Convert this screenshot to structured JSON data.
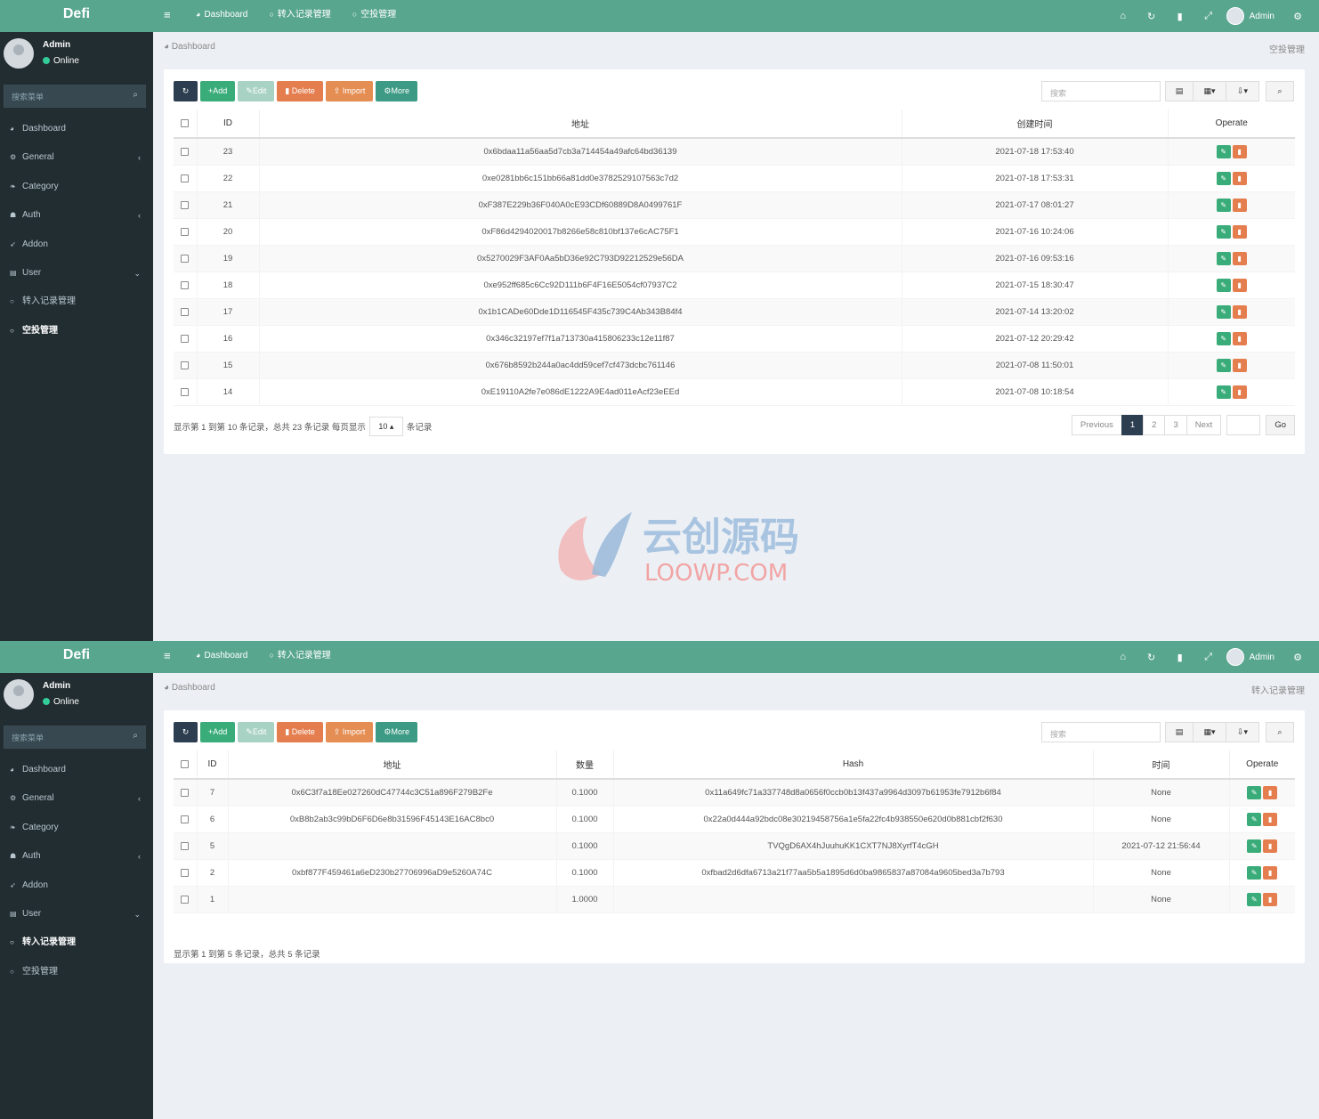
{
  "common": {
    "brand": "Defi",
    "topnav_dashboard": "Dashboard",
    "topnav_transfer": "转入记录管理",
    "topnav_airdrop": "空投管理",
    "admin_name": "Admin",
    "user_name": "Admin",
    "user_status": "Online",
    "sidebar_search": "搜索菜单",
    "breadcrumb": "Dashboard",
    "menu": [
      {
        "label": "Dashboard",
        "icon": "dashboard-icon"
      },
      {
        "label": "General",
        "icon": "cogs-icon",
        "arrow": "‹"
      },
      {
        "label": "Category",
        "icon": "leaf-icon"
      },
      {
        "label": "Auth",
        "icon": "group-icon",
        "arrow": "‹"
      },
      {
        "label": "Addon",
        "icon": "rocket-icon"
      },
      {
        "label": "User",
        "icon": "list-icon",
        "arrow": "⌄"
      },
      {
        "label": "转入记录管理",
        "icon": "circle-icon"
      },
      {
        "label": "空投管理",
        "icon": "circle-icon"
      }
    ],
    "toolbar": {
      "add": "Add",
      "edit": "Edit",
      "delete": "Delete",
      "import": "Import",
      "more": "More"
    },
    "search_placeholder": "搜索"
  },
  "screen1": {
    "breadcrumb_right": "空投管理",
    "columns": {
      "id": "ID",
      "address": "地址",
      "created": "创建时间",
      "operate": "Operate"
    },
    "rows": [
      {
        "id": "23",
        "address": "0x6bdaa11a56aa5d7cb3a714454a49afc64bd36139",
        "created": "2021-07-18 17:53:40"
      },
      {
        "id": "22",
        "address": "0xe0281bb6c151bb66a81dd0e3782529107563c7d2",
        "created": "2021-07-18 17:53:31"
      },
      {
        "id": "21",
        "address": "0xF387E229b36F040A0cE93CDf60889D8A0499761F",
        "created": "2021-07-17 08:01:27"
      },
      {
        "id": "20",
        "address": "0xF86d4294020017b8266e58c810bf137e6cAC75F1",
        "created": "2021-07-16 10:24:06"
      },
      {
        "id": "19",
        "address": "0x5270029F3AF0Aa5bD36e92C793D92212529e56DA",
        "created": "2021-07-16 09:53:16"
      },
      {
        "id": "18",
        "address": "0xe952ff685c6Cc92D111b6F4F16E5054cf07937C2",
        "created": "2021-07-15 18:30:47"
      },
      {
        "id": "17",
        "address": "0x1b1CADe60Dde1D116545F435c739C4Ab343B84f4",
        "created": "2021-07-14 13:20:02"
      },
      {
        "id": "16",
        "address": "0x346c32197ef7f1a713730a415806233c12e11f87",
        "created": "2021-07-12 20:29:42"
      },
      {
        "id": "15",
        "address": "0x676b8592b244a0ac4dd59cef7cf473dcbc761146",
        "created": "2021-07-08 11:50:01"
      },
      {
        "id": "14",
        "address": "0xE19110A2fe7e086dE1222A9E4ad011eAcf23eEEd",
        "created": "2021-07-08 10:18:54"
      }
    ],
    "pagination_info_1": "显示第 1 到第 10 条记录，总共 23 条记录 每页显示",
    "page_size": "10",
    "pagination_info_2": "条记录",
    "pager": {
      "prev": "Previous",
      "p1": "1",
      "p2": "2",
      "p3": "3",
      "next": "Next",
      "go": "Go"
    }
  },
  "screen2": {
    "breadcrumb_right": "转入记录管理",
    "columns": {
      "id": "ID",
      "address": "地址",
      "amount": "数量",
      "hash": "Hash",
      "time": "时间",
      "operate": "Operate"
    },
    "rows": [
      {
        "id": "7",
        "address": "0x6C3f7a18Ee027260dC47744c3C51a896F279B2Fe",
        "amount": "0.1000",
        "hash": "0x11a649fc71a337748d8a0656f0ccb0b13f437a9964d3097b61953fe7912b6f84",
        "time": "None"
      },
      {
        "id": "6",
        "address": "0xB8b2ab3c99bD6F6D6e8b31596F45143E16AC8bc0",
        "amount": "0.1000",
        "hash": "0x22a0d444a92bdc08e30219458756a1e5fa22fc4b938550e620d0b881cbf2f630",
        "time": "None"
      },
      {
        "id": "5",
        "address": "",
        "amount": "0.1000",
        "hash": "TVQgD6AX4hJuuhuKK1CXT7NJ8XyrfT4cGH",
        "time": "2021-07-12 21:56:44"
      },
      {
        "id": "2",
        "address": "0xbf877F459461a6eD230b27706996aD9e5260A74C",
        "amount": "0.1000",
        "hash": "0xfbad2d6dfa6713a21f77aa5b5a1895d6d0ba9865837a87084a9605bed3a7b793",
        "time": "None"
      },
      {
        "id": "1",
        "address": "",
        "amount": "1.0000",
        "hash": "",
        "time": "None"
      }
    ],
    "pagination_info": "显示第 1 到第 5 条记录，总共 5 条记录"
  },
  "watermark": {
    "cn": "云创源码",
    "en": "LOOWP.COM"
  },
  "colors": {
    "topbar": "#58a68e",
    "sidebar": "#222d32",
    "edit": "#3aac7a",
    "delete": "#e57e4f",
    "active_page": "#2c3e50"
  }
}
